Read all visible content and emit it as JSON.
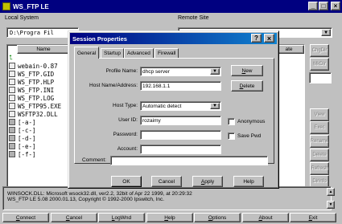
{
  "app": {
    "title": "WS_FTP LE",
    "controls": {
      "minimize": "_",
      "maximize": "□",
      "close": "×"
    }
  },
  "local": {
    "label": "Local System",
    "path": "D:\\Progra Fil",
    "column_name": "Name",
    "rows": [
      {
        "name": "webain-0.87",
        "icon": "file-icon"
      },
      {
        "name": "WS_FTP.GID",
        "icon": "file-icon"
      },
      {
        "name": "WS_FTP.HLP",
        "icon": "file-icon"
      },
      {
        "name": "WS_FTP.INI",
        "icon": "file-icon"
      },
      {
        "name": "WS_FTP.LOG",
        "icon": "file-icon"
      },
      {
        "name": "WS_FTP95.EXE",
        "icon": "file-icon"
      },
      {
        "name": "WSFTP32.DLL",
        "icon": "file-icon"
      },
      {
        "name": "[-a-]",
        "icon": "drive-icon"
      },
      {
        "name": "[-c-]",
        "icon": "drive-icon"
      },
      {
        "name": "[-d-]",
        "icon": "drive-icon"
      },
      {
        "name": "[-e-]",
        "icon": "drive-icon"
      },
      {
        "name": "[-f-]",
        "icon": "drive-icon"
      }
    ]
  },
  "remote": {
    "label": "Remote Site",
    "column_right": "ate",
    "buttons": [
      "ChgDir",
      "MkDir",
      "View",
      "Exec",
      "Rename",
      "Delete",
      "Refresh",
      "Dirinfo"
    ]
  },
  "dialog": {
    "title": "Session Properties",
    "help_glyph": "?",
    "close_glyph": "×",
    "tabs": [
      "General",
      "Startup",
      "Advanced",
      "Firewall"
    ],
    "active_tab": "General",
    "fields": {
      "profile_name": {
        "label": "Profile Name:",
        "value": "dhcp server"
      },
      "host_name": {
        "label": "Host Name/Address:",
        "value": "192.168.1.1"
      },
      "host_type": {
        "label": "Host Type:",
        "value": "Automatic detect"
      },
      "user_id": {
        "label": "User ID:",
        "value": "rozaimy"
      },
      "password": {
        "label": "Password:",
        "value": ""
      },
      "account": {
        "label": "Account:",
        "value": ""
      },
      "comment": {
        "label": "Comment:",
        "value": ""
      }
    },
    "checkboxes": {
      "anonymous": {
        "label": "Anonymous",
        "checked": false
      },
      "save_pwd": {
        "label": "Save Pwd",
        "checked": false
      }
    },
    "side_buttons": {
      "new": "New",
      "delete": "Delete"
    },
    "buttons": {
      "ok": "OK",
      "cancel": "Cancel",
      "apply": "Apply",
      "help": "Help"
    }
  },
  "log": {
    "lines": [
      "WINSOCK.DLL: Microsoft wsock32.dll, ver2.2, 32bit of Apr 22 1999, at 20:29:32",
      "WS_FTP LE 5.08 2000.01.13, Copyright © 1992-2000 Ipswitch, Inc."
    ]
  },
  "bottom_buttons": [
    "Connect",
    "Cancel",
    "LogWnd",
    "Help",
    "Options",
    "About",
    "Exit"
  ]
}
